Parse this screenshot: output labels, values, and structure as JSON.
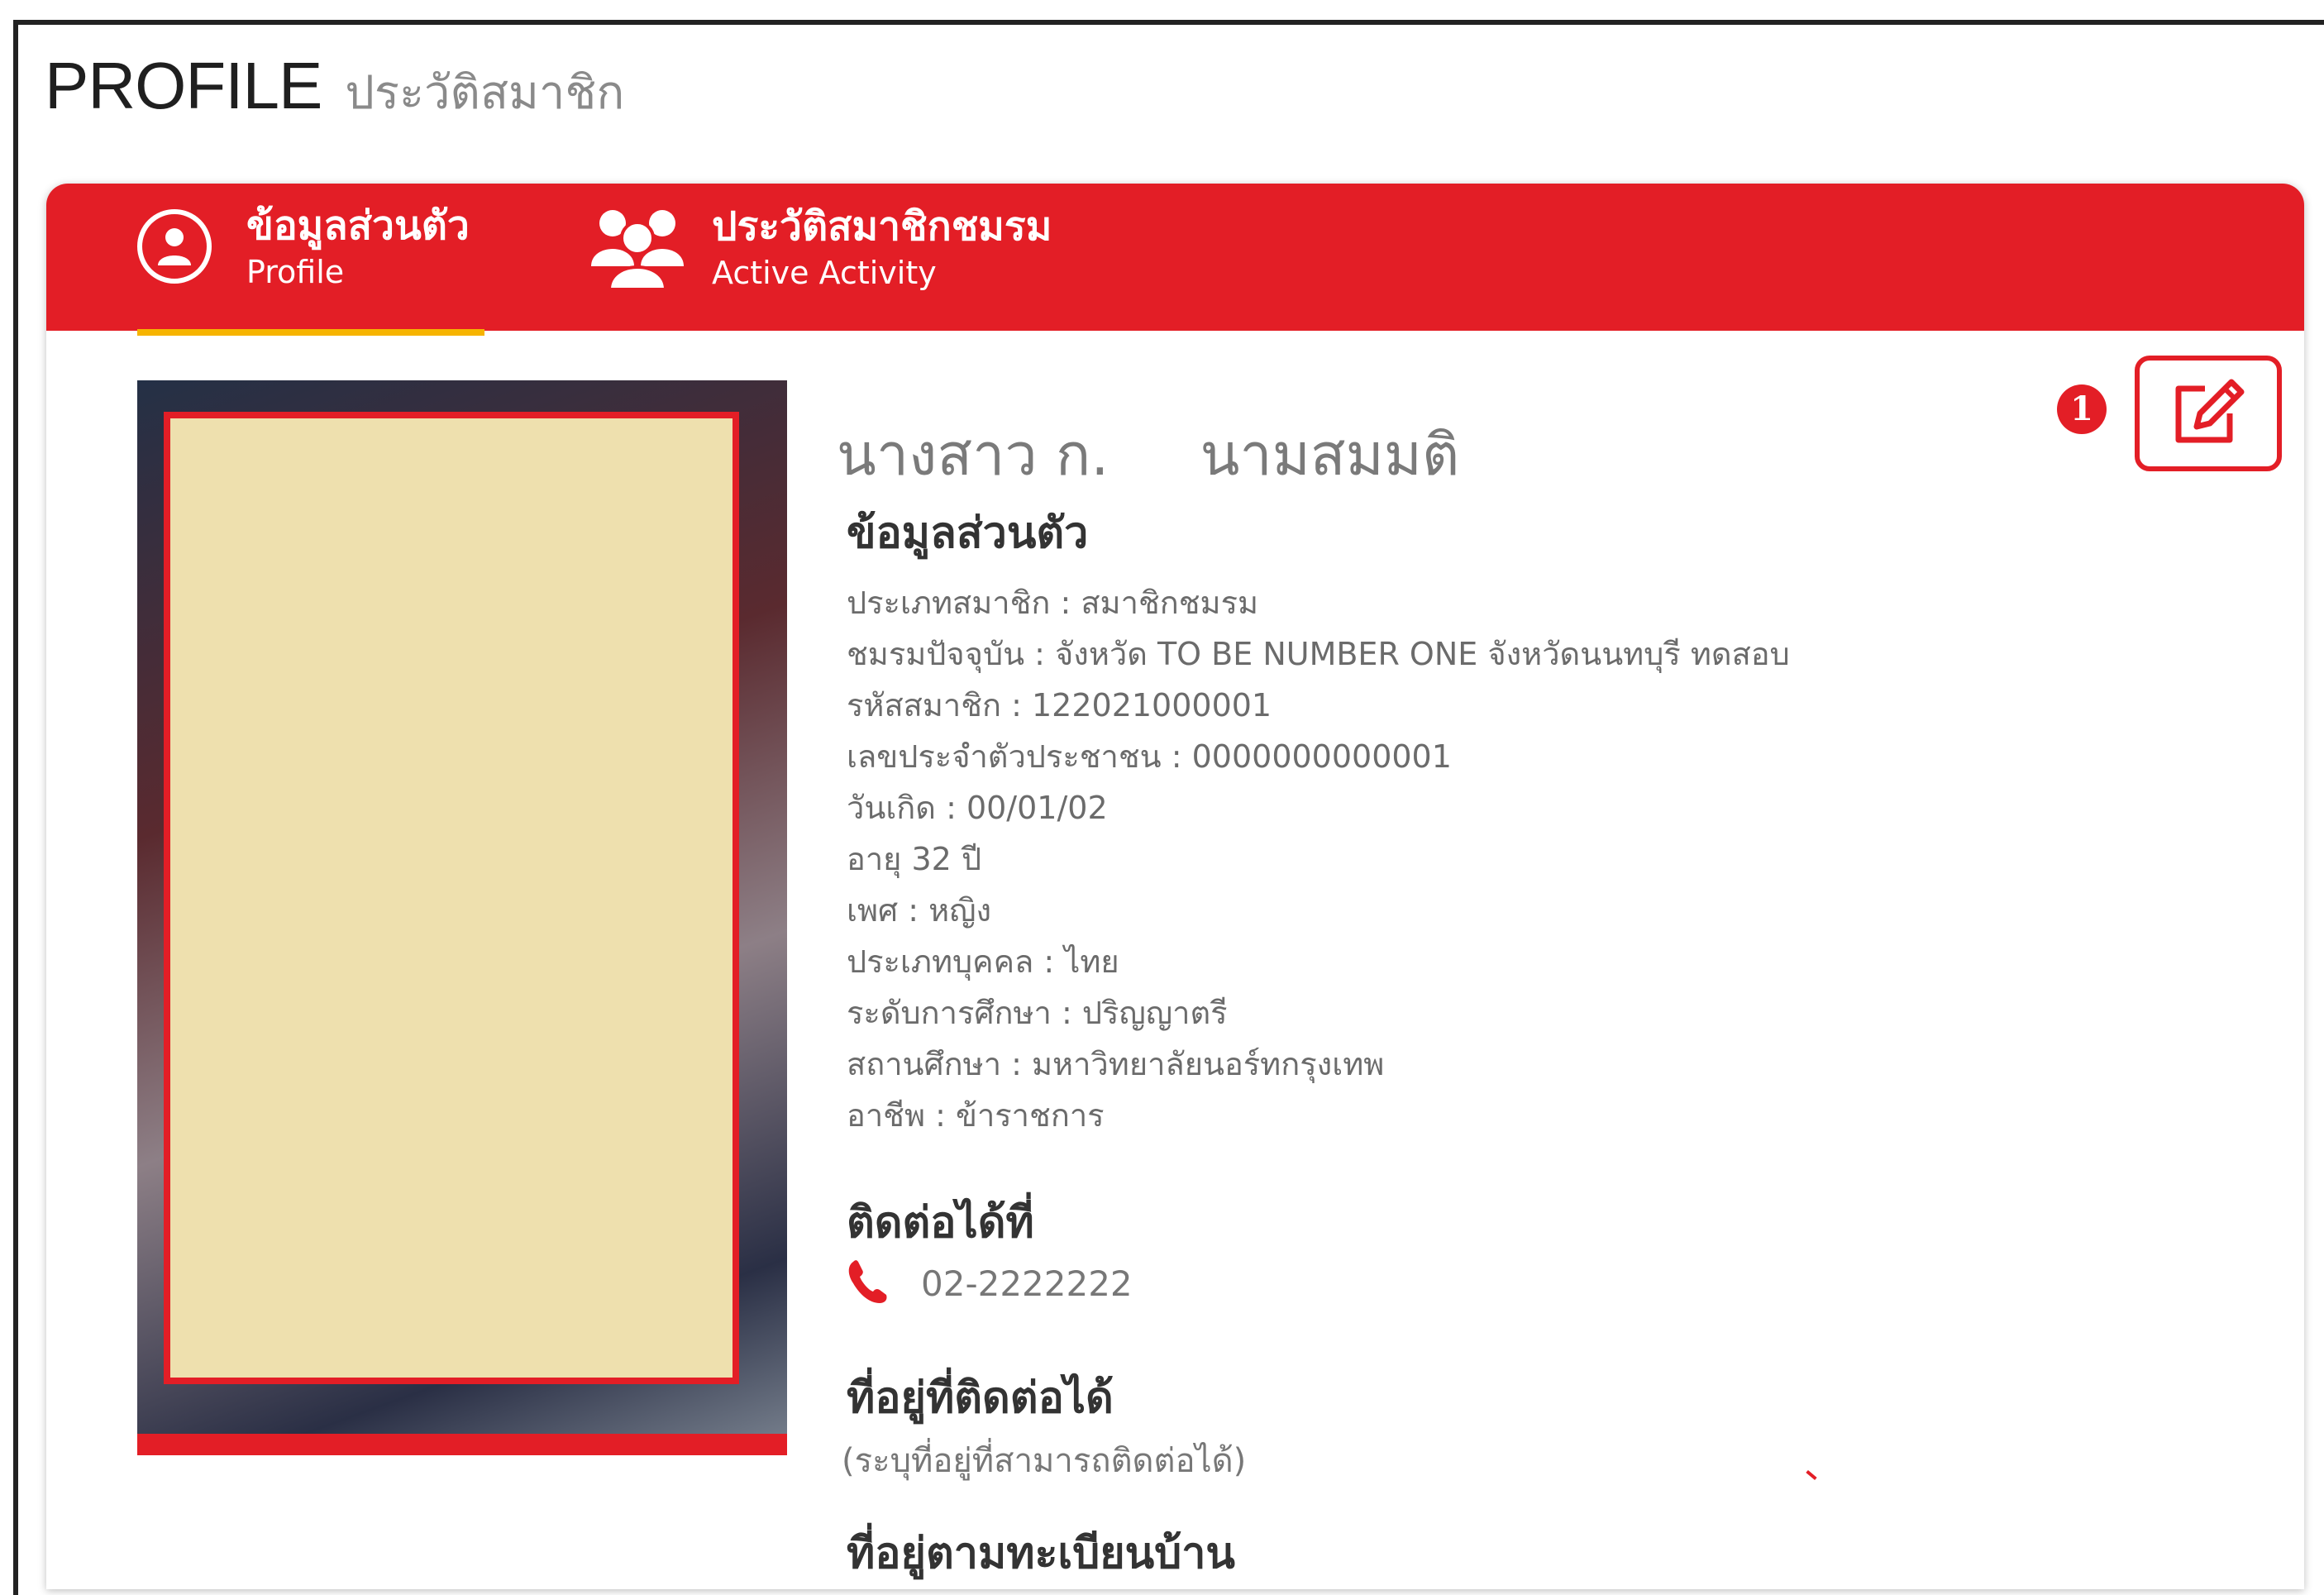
{
  "page": {
    "title": "PROFILE",
    "subtitle": "ประวัติสมาชิก"
  },
  "tabs": [
    {
      "th": "ข้อมูลส่วนตัว",
      "en": "Profile",
      "icon": "user-circle-icon",
      "active": true
    },
    {
      "th": "ประวัติสมาชิกชมรม",
      "en": "Active Activity",
      "icon": "group-icon",
      "active": false
    }
  ],
  "edit": {
    "step_badge": "1",
    "icon": "edit-icon"
  },
  "profile": {
    "name_first": "นางสาว ก.",
    "name_last": "นามสมมติ",
    "personal_heading": "ข้อมูลส่วนตัว",
    "fields": [
      "ประเภทสมาชิก : สมาชิกชมรม",
      "ชมรมปัจจุบัน : จังหวัด TO BE NUMBER ONE จังหวัดนนทบุรี ทดสอบ",
      "รหัสสมาชิก : 122021000001",
      "เลขประจำตัวประชาชน : 0000000000001",
      "วันเกิด : 00/01/02",
      "อายุ 32 ปี",
      "เพศ : หญิง",
      "ประเภทบุคคล : ไทย",
      "ระดับการศึกษา : ปริญญาตรี",
      "สถานศึกษา : มหาวิทยาลัยนอร์ทกรุงเทพ",
      "อาชีพ : ข้าราชการ"
    ],
    "contact_heading": "ติดต่อได้ที่",
    "phone": "02-2222222",
    "address_heading": "ที่อยู่ที่ติดต่อได้",
    "address_note": "(ระบุที่อยู่ที่สามารถติดต่อได้)",
    "registered_address_heading": "ที่อยู่ตามทะเบียนบ้าน"
  },
  "colors": {
    "accent": "#e31e26",
    "tab_underline": "#f6b400",
    "photo_placeholder": "#eee0ae"
  }
}
